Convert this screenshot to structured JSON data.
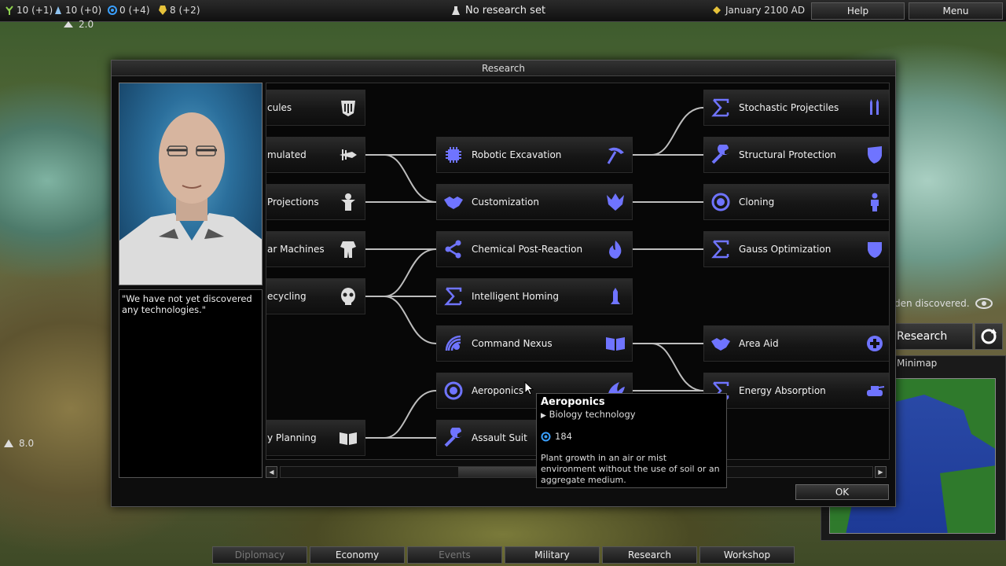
{
  "topbar": {
    "resources": [
      {
        "icon": "food-icon",
        "text": "10 (+1)",
        "color": "#8fd14f"
      },
      {
        "icon": "production-icon",
        "text": "10 (+0)",
        "color": "#8fc3f0"
      },
      {
        "icon": "science-icon",
        "text": "0 (+4)",
        "color": "#3aa0ff"
      },
      {
        "icon": "energy-icon",
        "text": "8 (+2)",
        "color": "#e6c23a"
      }
    ],
    "research_status": "No research set",
    "date": "January 2100 AD",
    "help_label": "Help",
    "menu_label": "Menu"
  },
  "map_overlay": {
    "unit_strength_top": "2.0",
    "unit_strength_left": "8.0"
  },
  "dialog": {
    "title": "Research",
    "quote": "\"We have not yet discovered any technologies.\"",
    "ok_label": "OK",
    "nodes": [
      {
        "id": "n1",
        "label": "cules",
        "left_icon": "",
        "right_icon": "armor-icon"
      },
      {
        "id": "n2",
        "label": "mulated",
        "left_icon": "",
        "right_icon": "drill-icon"
      },
      {
        "id": "n3",
        "label": "Projections",
        "left_icon": "",
        "right_icon": "figure-icon"
      },
      {
        "id": "n4",
        "label": "ar Machines",
        "left_icon": "",
        "right_icon": "mech-icon"
      },
      {
        "id": "n5",
        "label": "ecycling",
        "left_icon": "",
        "right_icon": "skull-icon"
      },
      {
        "id": "n6",
        "label": "y Planning",
        "left_icon": "",
        "right_icon": "book-icon"
      },
      {
        "id": "n7",
        "label": "Robotic Excavation",
        "left_icon": "gear-chip-icon",
        "right_icon": "pickaxe-icon"
      },
      {
        "id": "n8",
        "label": "Customization",
        "left_icon": "handshake-icon",
        "right_icon": "emblem-icon"
      },
      {
        "id": "n9",
        "label": "Chemical Post-Reaction",
        "left_icon": "molecule-icon",
        "right_icon": "flame-icon"
      },
      {
        "id": "n10",
        "label": "Intelligent Homing",
        "left_icon": "sigma-icon",
        "right_icon": "missile-icon"
      },
      {
        "id": "n11",
        "label": "Command Nexus",
        "left_icon": "radar-icon",
        "right_icon": "open-book-icon"
      },
      {
        "id": "n12",
        "label": "Aeroponics",
        "left_icon": "biology-icon",
        "right_icon": "leaf-icon"
      },
      {
        "id": "n13",
        "label": "Assault Suit",
        "left_icon": "wrench-icon",
        "right_icon": "helmet-icon"
      },
      {
        "id": "n14",
        "label": "Stochastic Projectiles",
        "left_icon": "sigma-icon",
        "right_icon": "bullets-icon"
      },
      {
        "id": "n15",
        "label": "Structural Protection",
        "left_icon": "wrench-icon",
        "right_icon": "shield-icon"
      },
      {
        "id": "n16",
        "label": "Cloning",
        "left_icon": "biology-icon",
        "right_icon": "person-icon"
      },
      {
        "id": "n17",
        "label": "Gauss Optimization",
        "left_icon": "sigma-icon",
        "right_icon": "shield-icon"
      },
      {
        "id": "n18",
        "label": "Area Aid",
        "left_icon": "handshake-icon",
        "right_icon": "medic-icon"
      },
      {
        "id": "n19",
        "label": "Energy Absorption",
        "left_icon": "sigma-icon",
        "right_icon": "tank-icon"
      }
    ],
    "tooltip": {
      "title": "Aeroponics",
      "subtitle": "Biology technology",
      "cost": "184",
      "description": "Plant growth in an air or mist environment without the use of soil or an aggregate medium."
    }
  },
  "side_panel": {
    "discovered_text": "den discovered.",
    "research_label": "Research",
    "minimap_label": "Minimap"
  },
  "bottombar": [
    {
      "label": "Diplomacy",
      "enabled": false
    },
    {
      "label": "Economy",
      "enabled": true
    },
    {
      "label": "Events",
      "enabled": false
    },
    {
      "label": "Military",
      "enabled": true
    },
    {
      "label": "Research",
      "enabled": true
    },
    {
      "label": "Workshop",
      "enabled": true
    }
  ],
  "colors": {
    "tech_icon": "#6f74ff",
    "panel_bg": "#0d0d0d"
  }
}
